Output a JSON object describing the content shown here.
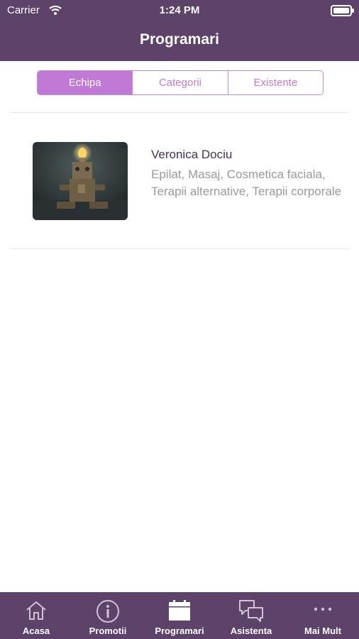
{
  "status_bar": {
    "carrier": "Carrier",
    "time": "1:24 PM"
  },
  "header": {
    "title": "Programari"
  },
  "segments": [
    {
      "label": "Echipa",
      "active": true
    },
    {
      "label": "Categorii",
      "active": false
    },
    {
      "label": "Existente",
      "active": false
    }
  ],
  "list": [
    {
      "name": "Veronica Dociu",
      "services": "Epilat, Masaj, Cosmetica faciala, Terapii alternative, Terapii corporale"
    }
  ],
  "tabbar": {
    "items": [
      {
        "label": "Acasa",
        "icon": "home-icon"
      },
      {
        "label": "Promotii",
        "icon": "info-icon"
      },
      {
        "label": "Programari",
        "icon": "calendar-icon"
      },
      {
        "label": "Asistenta",
        "icon": "chat-bubbles-icon"
      },
      {
        "label": "Mai Mult",
        "icon": "more-dots-icon"
      }
    ]
  },
  "colors": {
    "header": "#5d426a",
    "accent": "#c07ad6",
    "name": "#4a3152"
  }
}
